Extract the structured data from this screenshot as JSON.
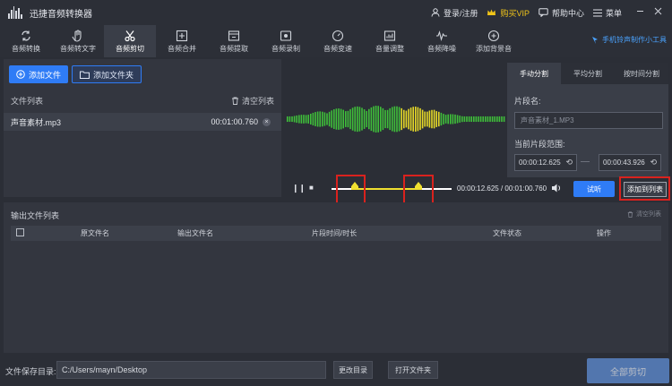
{
  "app": {
    "title": "迅捷音频转换器"
  },
  "titlebar": {
    "login_label": "登录/注册",
    "vip_label": "购买VIP",
    "help_label": "帮助中心",
    "menu_label": "菜单"
  },
  "toolbar": {
    "tools": [
      {
        "label": "音频转换",
        "icon": "convert-icon"
      },
      {
        "label": "音频转文字",
        "icon": "hand-icon"
      },
      {
        "label": "音频剪切",
        "icon": "scissors-icon"
      },
      {
        "label": "音频合并",
        "icon": "merge-icon"
      },
      {
        "label": "音频提取",
        "icon": "extract-icon"
      },
      {
        "label": "音频录制",
        "icon": "record-icon"
      },
      {
        "label": "音频变速",
        "icon": "speed-icon"
      },
      {
        "label": "音量调整",
        "icon": "volume-icon"
      },
      {
        "label": "音频降噪",
        "icon": "denoise-icon"
      },
      {
        "label": "添加背景音",
        "icon": "bg-music-icon"
      }
    ],
    "active_index": 2,
    "ringtone_label": "手机铃声制作小工具"
  },
  "file_panel": {
    "add_file_label": "添加文件",
    "add_folder_label": "添加文件夹",
    "list_label": "文件列表",
    "clear_label": "清空列表",
    "files": [
      {
        "name": "声音素材.mp3",
        "duration": "00:01:00.760"
      }
    ]
  },
  "player": {
    "current_time": "00:00:12.625",
    "total_time": "00:01:00.760",
    "try_label": "试听",
    "add_to_list_label": "添加到列表",
    "selection_start_fraction": 0.208,
    "selection_end_fraction": 0.722
  },
  "split_panel": {
    "tabs": [
      "手动分割",
      "平均分割",
      "按时间分割"
    ],
    "active_tab": 0,
    "segment_name_label": "片段名:",
    "segment_name_placeholder": "声音素材_1.MP3",
    "range_label": "当前片段范围:",
    "start_time": "00:00:12.625",
    "end_time": "00:00:43.926"
  },
  "output_panel": {
    "title": "输出文件列表",
    "clear_label": "清空列表",
    "columns": [
      "原文件名",
      "输出文件名",
      "片段时间/时长",
      "文件状态",
      "操作"
    ]
  },
  "footer": {
    "save_dir_label": "文件保存目录:",
    "save_dir_value": "C:/Users/mayn/Desktop",
    "change_dir_label": "更改目录",
    "open_folder_label": "打开文件夹",
    "convert_all_label": "全部剪切"
  },
  "colors": {
    "accent": "#2f7cf6",
    "vip": "#f0c419",
    "highlight_box": "#d9221e",
    "wave_green": "#3fbf3a",
    "wave_yellow": "#e6d928",
    "selection": "#f0e030"
  }
}
